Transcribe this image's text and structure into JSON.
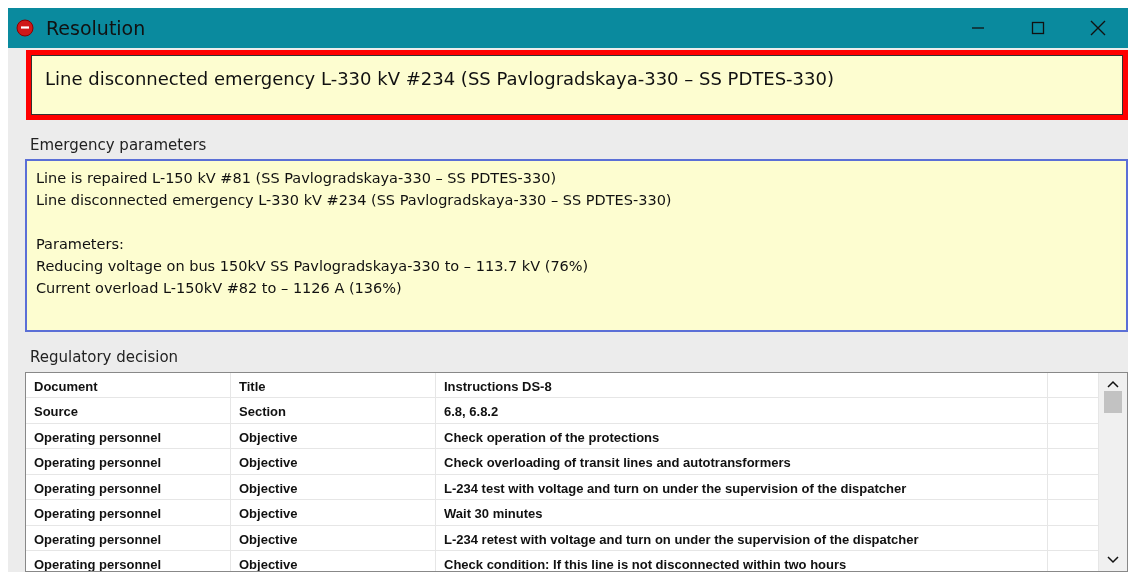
{
  "window": {
    "title": "Resolution"
  },
  "alert": {
    "text": "Line disconnected emergency L-330 kV #234 (SS Pavlogradskaya-330 – SS PDTES-330)"
  },
  "emergency_parameters": {
    "label": "Emergency parameters",
    "lines": [
      {
        "text": "Line is repaired L-150 kV #81 (SS Pavlogradskaya-330 – SS PDTES-330)"
      },
      {
        "text": "Line disconnected emergency L-330 kV #234 (SS Pavlogradskaya-330 – SS PDTES-330)"
      },
      {
        "text": "Parameters:",
        "gap_before": true
      },
      {
        "text": "Reducing voltage on bus 150kV SS Pavlogradskaya-330 to – 113.7 kV (76%)"
      },
      {
        "text": "Current overload L-150kV #82 to – 1126 A (136%)"
      }
    ]
  },
  "regulatory_decision": {
    "label": "Regulatory decision",
    "rows": [
      [
        "Document",
        "Title",
        "Instructions DS-8"
      ],
      [
        "Source",
        "Section",
        "6.8, 6.8.2"
      ],
      [
        "Operating personnel",
        "Objective",
        "Check operation of the protections"
      ],
      [
        "Operating personnel",
        "Objective",
        "Check overloading of transit lines and autotransformers"
      ],
      [
        "Operating personnel",
        "Objective",
        "L-234 test with voltage and turn on under the supervision of the dispatcher"
      ],
      [
        "Operating personnel",
        "Objective",
        "Wait 30 minutes"
      ],
      [
        "Operating personnel",
        "Objective",
        "L-234 retest with voltage and turn on under the supervision of the dispatcher"
      ],
      [
        "Operating personnel",
        "Objective",
        "Check condition: If this line is not disconnected within two hours"
      ]
    ]
  }
}
